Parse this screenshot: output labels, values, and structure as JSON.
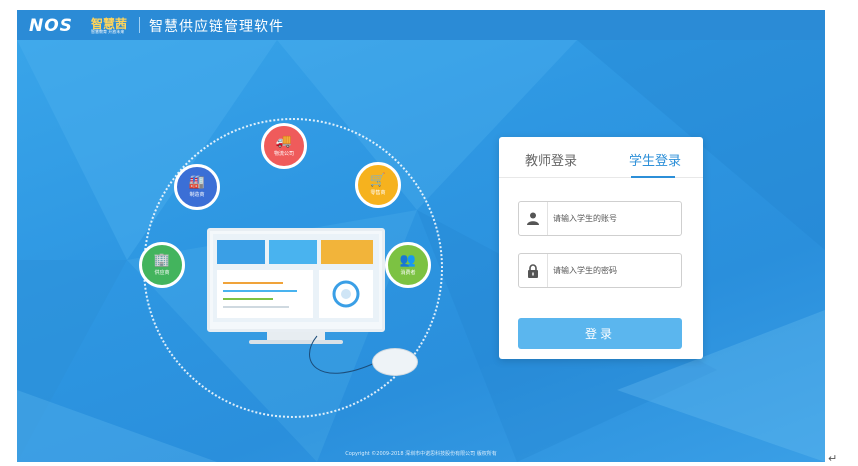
{
  "header": {
    "logo_text": "NOS",
    "brand_cn": "智慧茜",
    "brand_tagline": "智慧教育 开放未来",
    "app_title": "智慧供应链管理软件"
  },
  "diagram": {
    "nodes": [
      {
        "label": "物流公司",
        "icon": "delivery-truck-icon",
        "color": "#ef5b5b"
      },
      {
        "label": "零售商",
        "icon": "shopping-cart-icon",
        "color": "#f6b21e"
      },
      {
        "label": "消费者",
        "icon": "consumers-icon",
        "color": "#7cc242"
      },
      {
        "label": "制造商",
        "icon": "factory-icon",
        "color": "#3b6fd6"
      },
      {
        "label": "供应商",
        "icon": "warehouse-icon",
        "color": "#43b45d"
      }
    ]
  },
  "login": {
    "tab_teacher": "教师登录",
    "tab_student": "学生登录",
    "account_placeholder": "请输入学生的账号",
    "password_placeholder": "请输入学生的密码",
    "submit_label": "登录"
  },
  "footer": {
    "copyright": "Copyright ©2009-2018 深圳市中诺思科技股份有限公司 版权所有"
  },
  "return_symbol": "↵"
}
